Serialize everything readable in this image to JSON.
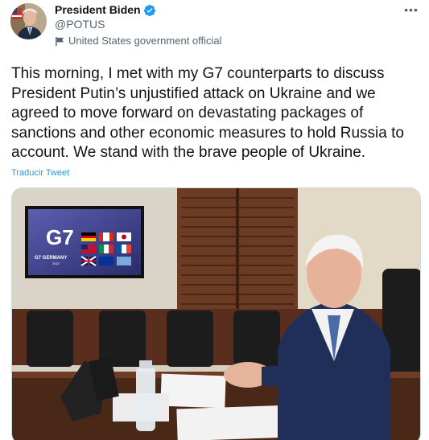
{
  "author": {
    "display_name": "President Biden",
    "handle": "@POTUS",
    "label": "United States government official",
    "verified": true,
    "avatar_icon": "profile-photo",
    "more_icon": "more-horizontal-icon"
  },
  "tweet": {
    "text": "This morning, I met with my G7 counterparts to discuss President Putin’s unjustified attack on Ukraine and we agreed to move forward on devastating packages of sanctions and other economic measures to hold Russia to account. We stand with the brave people of Ukraine.",
    "translate_link": "Traducir Tweet"
  },
  "media": {
    "screen_logo": "G7",
    "screen_caption": "G7 GERMANY",
    "screen_year": "2022"
  },
  "colors": {
    "accent": "#1d9bf0",
    "text": "#0f1419",
    "secondary": "#536471"
  }
}
